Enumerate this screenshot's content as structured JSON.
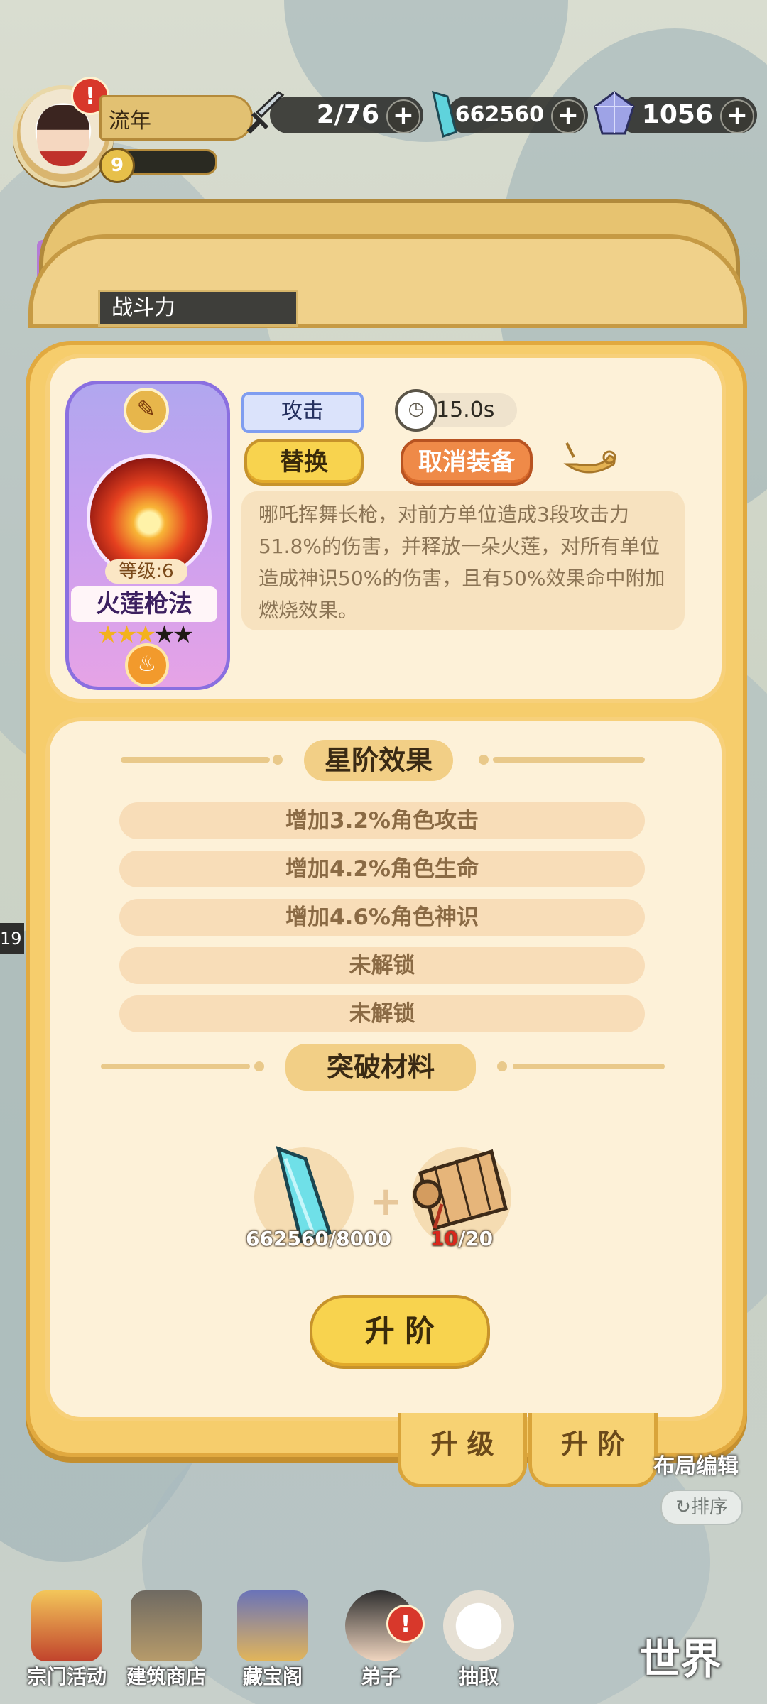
{
  "player": {
    "name": "流年",
    "level": "9",
    "alert": "!"
  },
  "resources": [
    {
      "icon": "sword-icon",
      "value": "2/76"
    },
    {
      "icon": "crystal-icon",
      "value": "662560"
    },
    {
      "icon": "gem-icon",
      "value": "1056"
    }
  ],
  "background_tab": "战斗力",
  "skill": {
    "name": "火莲枪法",
    "level_label": "等级:6",
    "stars_filled": 3,
    "stars_total": 5,
    "type_tag": "攻击",
    "cooldown": "15.0s",
    "description": "哪吒挥舞长枪，对前方单位造成3段攻击力51.8%的伤害，并释放一朵火莲，对所有单位造成神识50%的伤害，且有50%效果命中附加燃烧效果。"
  },
  "buttons": {
    "replace": "替换",
    "unequip": "取消装备",
    "advance": "升 阶"
  },
  "star_effects": {
    "title": "星阶效果",
    "items": [
      "增加3.2%角色攻击",
      "增加4.2%角色生命",
      "增加4.6%角色神识",
      "未解锁",
      "未解锁"
    ]
  },
  "materials": {
    "title": "突破材料",
    "items": [
      {
        "icon": "crystal-shard-icon",
        "have": "662560",
        "need": "/8000"
      },
      {
        "icon": "scroll-icon",
        "have": "10",
        "need": "/20"
      }
    ],
    "plus": "+"
  },
  "bottom_tabs": [
    "升 级",
    "升 阶"
  ],
  "side": {
    "layout_edit": "布局编辑",
    "sort": "排序",
    "number": "19"
  },
  "nav": [
    {
      "label": "宗门活动",
      "icon": "pagoda-icon"
    },
    {
      "label": "建筑商店",
      "icon": "shop-icon"
    },
    {
      "label": "藏宝阁",
      "icon": "treasure-icon"
    },
    {
      "label": "弟子",
      "icon": "disciple-icon",
      "alert": "!"
    },
    {
      "label": "抽取",
      "icon": "owl-icon"
    }
  ],
  "world": "世界",
  "colors": {
    "panel": "#f6cd6c",
    "card": "#fdf1d8",
    "accent_orange": "#ef8a48",
    "accent_yellow": "#f8d34e",
    "star": "#f3b21d"
  }
}
